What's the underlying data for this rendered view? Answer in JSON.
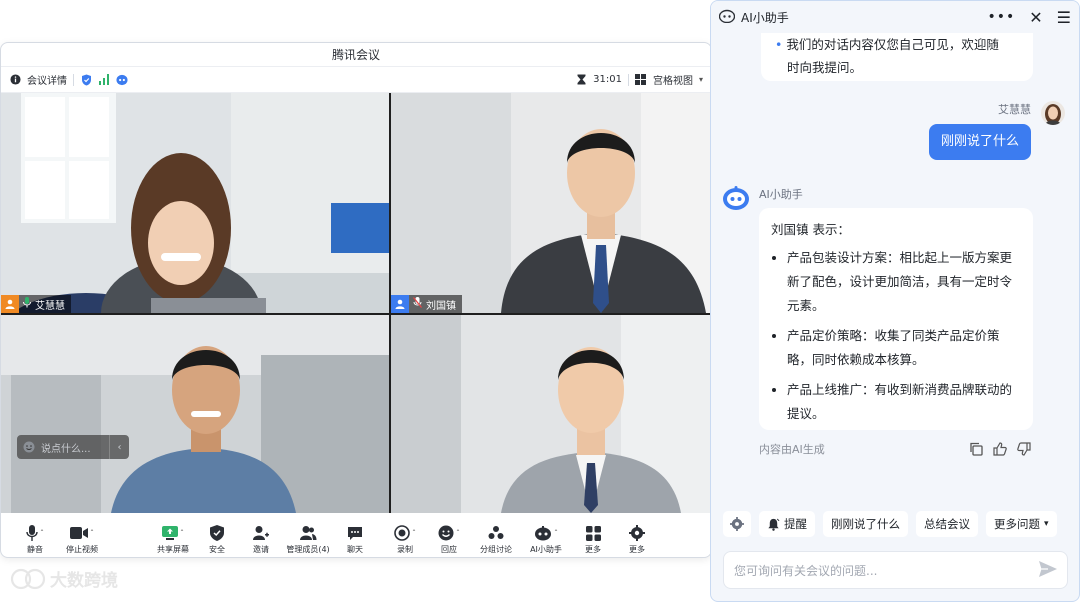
{
  "meeting": {
    "window_title": "腾讯会议",
    "info_label": "会议详情",
    "timer": "31:01",
    "view_label": "宫格视图",
    "participants": [
      {
        "name": "艾慧慧",
        "avatar_color": "#f08a24"
      },
      {
        "name": "刘国镇",
        "avatar_color": "#3c7cf0"
      }
    ],
    "speak_hint": "说点什么...",
    "toolbar": [
      {
        "label": "静音",
        "icon": "mic-icon"
      },
      {
        "label": "停止视频",
        "icon": "camera-icon"
      },
      {
        "label": "共享屏幕",
        "icon": "share-screen-icon"
      },
      {
        "label": "安全",
        "icon": "shield-icon"
      },
      {
        "label": "邀请",
        "icon": "invite-icon"
      },
      {
        "label": "管理成员(4)",
        "icon": "members-icon"
      },
      {
        "label": "聊天",
        "icon": "chat-icon"
      },
      {
        "label": "录制",
        "icon": "record-icon"
      },
      {
        "label": "回应",
        "icon": "reaction-icon"
      },
      {
        "label": "分组讨论",
        "icon": "breakout-icon"
      },
      {
        "label": "AI小助手",
        "icon": "ai-assistant-icon"
      },
      {
        "label": "更多",
        "icon": "apps-icon"
      },
      {
        "label": "更多",
        "icon": "settings-icon"
      }
    ]
  },
  "ai_panel": {
    "title": "AI小助手",
    "prev_message_lines": [
      "我们的对话内容仅您自己可见，欢迎随",
      "时向我提问。"
    ],
    "user_name": "艾慧慧",
    "user_message": "刚刚说了什么",
    "bot_name": "AI小助手",
    "bot_intro": "刘国镇 表示：",
    "bot_points": [
      "产品包装设计方案：相比起上一版方案更新了配色，设计更加简洁，具有一定时令元素。",
      "产品定价策略：收集了同类产品定价策略，同时依赖成本核算。",
      "产品上线推广：有收到新消费品牌联动的提议。"
    ],
    "generated_note": "内容由AI生成",
    "quick_actions": {
      "remind": "提醒",
      "what_said": "刚刚说了什么",
      "summarize": "总结会议",
      "more": "更多问题"
    },
    "input_placeholder": "您可询问有关会议的问题..."
  },
  "watermark": "大数跨境",
  "colors": {
    "accent": "#3c7cf0",
    "panel_bg": "#f3f6fb"
  }
}
